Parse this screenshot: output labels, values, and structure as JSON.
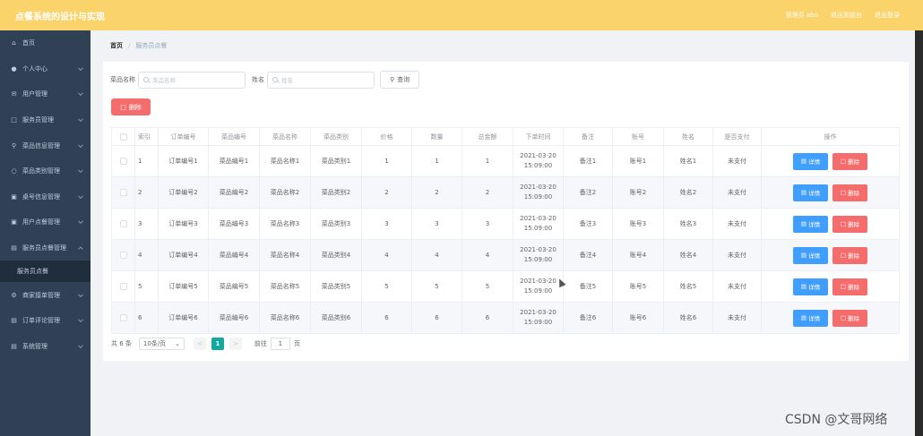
{
  "header": {
    "title": "点餐系统的设计与实现",
    "user_label": "管理员 abo",
    "back_to_front": "退出到前台",
    "logout": "退出登录"
  },
  "sidebar": {
    "items": [
      {
        "label": "首页",
        "icon": "home-icon"
      },
      {
        "label": "个人中心",
        "icon": "user-icon"
      },
      {
        "label": "用户管理",
        "icon": "mail-icon"
      },
      {
        "label": "服务员管理",
        "icon": "chat-icon"
      },
      {
        "label": "菜品信息管理",
        "icon": "location-icon"
      },
      {
        "label": "菜品类别管理",
        "icon": "search-icon"
      },
      {
        "label": "桌号信息管理",
        "icon": "chat-icon"
      },
      {
        "label": "用户点餐管理",
        "icon": "chat-icon"
      },
      {
        "label": "服务员点餐管理",
        "icon": "doc-icon"
      },
      {
        "label": "服务员点餐",
        "icon": ""
      },
      {
        "label": "商家接单管理",
        "icon": "gear-icon"
      },
      {
        "label": "订单评论管理",
        "icon": "chat-icon"
      },
      {
        "label": "系统管理",
        "icon": "doc-icon"
      }
    ]
  },
  "breadcrumb": {
    "home": "首页",
    "sep": "/",
    "current": "服务员点餐"
  },
  "search": {
    "dish_label": "菜品名称",
    "dish_placeholder": "菜品名称",
    "name_label": "姓名",
    "name_placeholder": "姓名",
    "query_button": "查询"
  },
  "toolbar": {
    "delete_label": "删除"
  },
  "table": {
    "headers": [
      "索引",
      "订单编号",
      "菜品编号",
      "菜品名称",
      "菜品类别",
      "价格",
      "数量",
      "总金额",
      "下单时间",
      "备注",
      "账号",
      "姓名",
      "是否支付",
      "操作"
    ],
    "detail_label": "详情",
    "delete_label": "删除",
    "rows": [
      {
        "index": "1",
        "order": "订单编号1",
        "dish_no": "菜品编号1",
        "dish_name": "菜品名称1",
        "category": "菜品类别1",
        "price": "1",
        "qty": "1",
        "total": "1",
        "date": "2021-03-20",
        "time": "15:09:00",
        "note": "备注1",
        "account": "账号1",
        "name": "姓名1",
        "paid": "未支付"
      },
      {
        "index": "2",
        "order": "订单编号2",
        "dish_no": "菜品编号2",
        "dish_name": "菜品名称2",
        "category": "菜品类别2",
        "price": "2",
        "qty": "2",
        "total": "2",
        "date": "2021-03-20",
        "time": "15:09:00",
        "note": "备注2",
        "account": "账号2",
        "name": "姓名2",
        "paid": "未支付"
      },
      {
        "index": "3",
        "order": "订单编号3",
        "dish_no": "菜品编号3",
        "dish_name": "菜品名称3",
        "category": "菜品类别3",
        "price": "3",
        "qty": "3",
        "total": "3",
        "date": "2021-03-20",
        "time": "15:09:00",
        "note": "备注3",
        "account": "账号3",
        "name": "姓名3",
        "paid": "未支付"
      },
      {
        "index": "4",
        "order": "订单编号4",
        "dish_no": "菜品编号4",
        "dish_name": "菜品名称4",
        "category": "菜品类别4",
        "price": "4",
        "qty": "4",
        "total": "4",
        "date": "2021-03-20",
        "time": "15:09:00",
        "note": "备注4",
        "account": "账号4",
        "name": "姓名4",
        "paid": "未支付"
      },
      {
        "index": "5",
        "order": "订单编号5",
        "dish_no": "菜品编号5",
        "dish_name": "菜品名称5",
        "category": "菜品类别5",
        "price": "5",
        "qty": "5",
        "total": "5",
        "date": "2021-03-20",
        "time": "15:09:00",
        "note": "备注5",
        "account": "账号5",
        "name": "姓名5",
        "paid": "未支付"
      },
      {
        "index": "6",
        "order": "订单编号6",
        "dish_no": "菜品编号6",
        "dish_name": "菜品名称6",
        "category": "菜品类别6",
        "price": "6",
        "qty": "6",
        "total": "6",
        "date": "2021-03-20",
        "time": "15:09:00",
        "note": "备注6",
        "account": "账号6",
        "name": "姓名6",
        "paid": "未支付"
      }
    ]
  },
  "pagination": {
    "total": "共 6 条",
    "page_size": "10条/页",
    "prev": "<",
    "current_page": "1",
    "next": ">",
    "goto": "前往",
    "goto_value": "1",
    "page_unit": "页"
  },
  "watermark": "CSDN @文哥网络",
  "colors": {
    "topbar": "#fbd36b",
    "sidebar": "#304156",
    "primary": "#409eff",
    "danger": "#f56c6c",
    "pager_active": "#13a89e"
  }
}
